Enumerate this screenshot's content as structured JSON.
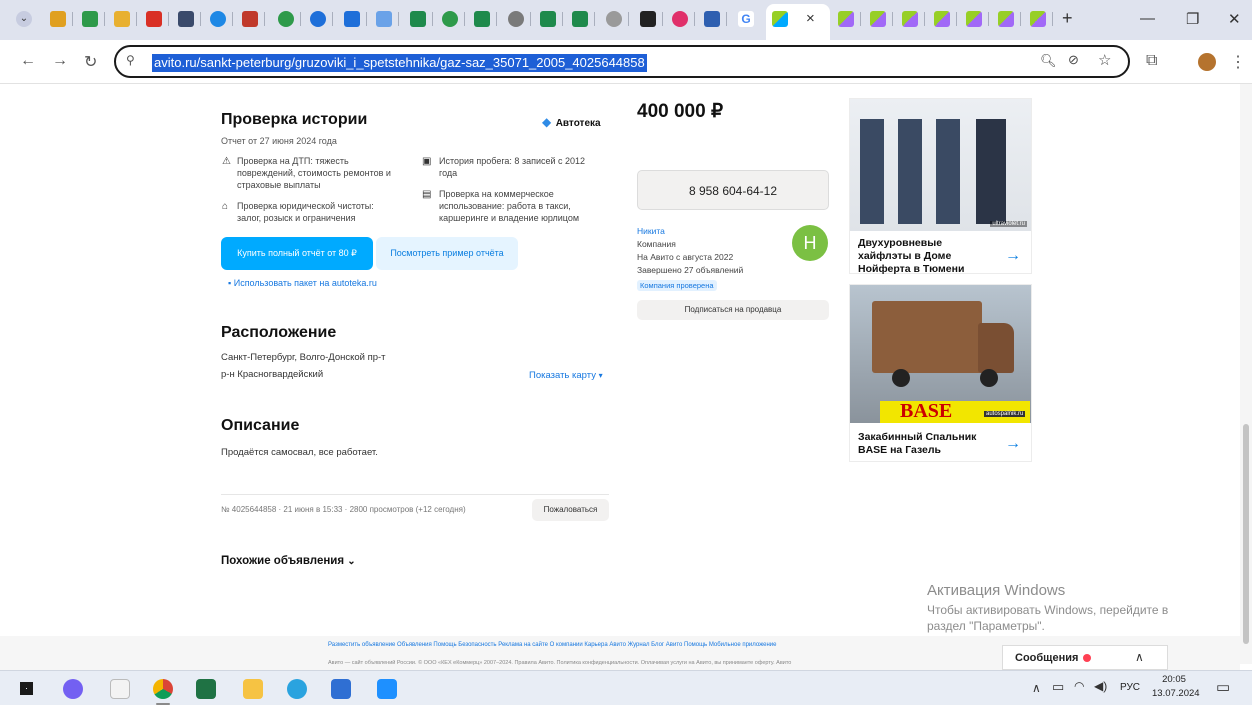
{
  "browser": {
    "url": "avito.ru/sankt-peterburg/gruzoviki_i_spetstehnika/gaz-saz_35071_2005_4025644858",
    "tab_close": "×",
    "new_tab": "+",
    "win_min": "—",
    "win_restore": "❐",
    "win_close": "✕"
  },
  "history": {
    "title": "Проверка истории",
    "date": "Отчет от 27 июня 2024 года",
    "brand": "Автотека",
    "feature1": "Проверка на ДТП: тяжесть повреждений, стоимость ремонтов и страховые выплаты",
    "feature2": "Проверка юридической чистоты: залог, розыск и ограничения",
    "feature3": "История пробега: 8 записей с 2012 года",
    "feature4": "Проверка на коммерческое использование: работа в такси, каршеринге и владение юрлицом",
    "buy_button": "Купить полный отчёт от 80 ₽",
    "sample_button": "Посмотреть пример отчёта",
    "package_link": "Использовать пакет на autoteka.ru"
  },
  "location": {
    "title": "Расположение",
    "address_line1": "Санкт-Петербург, Волго-Донской пр-т",
    "address_line2": "р-н Красногвардейский",
    "map_link": "Показать карту"
  },
  "description": {
    "title": "Описание",
    "text": "Продаётся самосвал, все работает."
  },
  "meta": {
    "info": "№ 4025644858 · 21 июня в 15:33 · 2800 просмотров (+12 сегодня)",
    "report_button": "Пожаловаться"
  },
  "similar": {
    "label": "Похожие объявления"
  },
  "listing": {
    "price": "400 000 ₽",
    "phone": "8 958 604-64-12"
  },
  "seller": {
    "name": "Никита",
    "type": "Компания",
    "since": "На Авито с августа 2022",
    "completed": "Завершено 27 объявлений",
    "badge": "Компания проверена",
    "avatar_letter": "Н",
    "subscribe_button": "Подписаться на продавца"
  },
  "ads": [
    {
      "title": "Двухуровневые хайфлэты в Доме Нойферта в Тюмени",
      "caption": "ultraviolet.ru"
    },
    {
      "title": "Закабинный Спальник BASE на Газель",
      "caption": "BASE",
      "site": "autospalnik.ru"
    }
  ],
  "footer": {
    "links": "Разместить объявление   Объявления   Помощь   Безопасность   Реклама на сайте   О компании   Карьера   Авито Журнал   Блог   Авито Помощь   Мобильное приложение",
    "legal": "Авито — сайт объявлений России. © ООО «КЕХ еКоммерц» 2007–2024. Правила Авито. Политика конфиденциальности. Оплачивая услуги на Авито, вы принимаете оферту. Авито"
  },
  "windows": {
    "activation_title": "Активация Windows",
    "activation_text1": "Чтобы активировать Windows, перейдите в",
    "activation_text2": "раздел \"Параметры\".",
    "messages_label": "Сообщения",
    "lang": "РУС",
    "time": "20:05",
    "date": "13.07.2024"
  },
  "colors": {
    "accent": "#00aaff",
    "link": "#1778e0",
    "avatar": "#7bc043"
  }
}
